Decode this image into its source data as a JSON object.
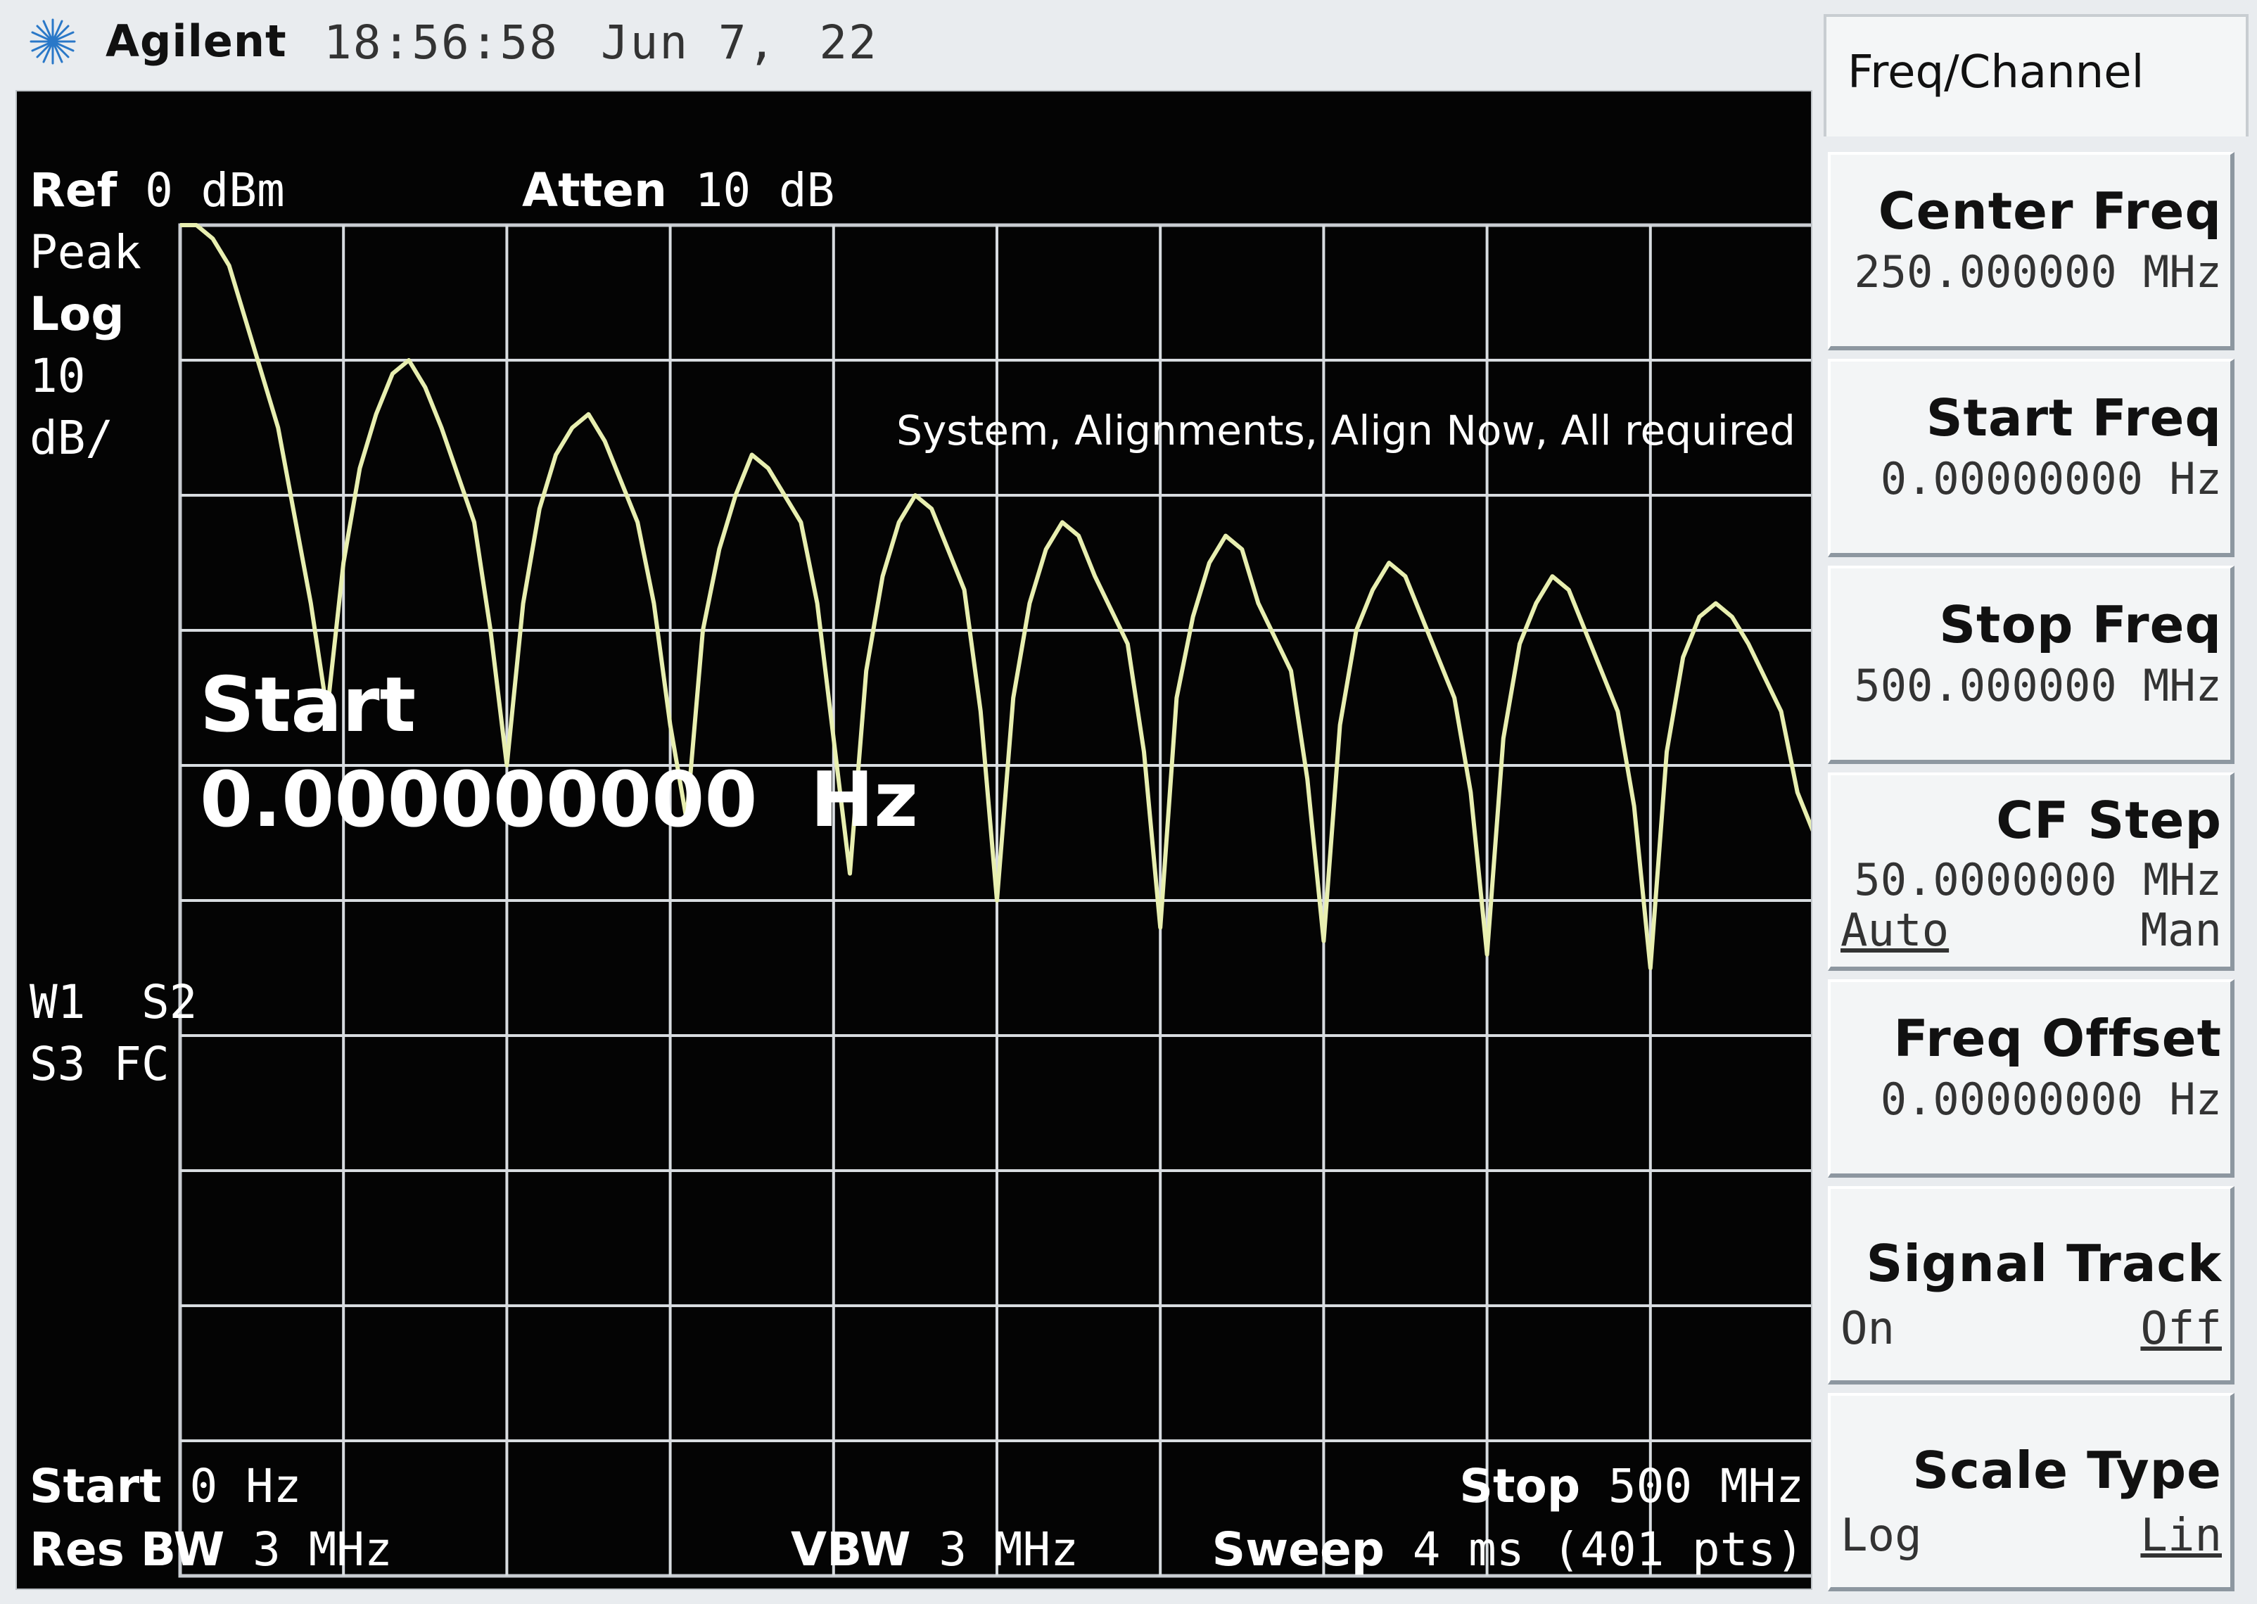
{
  "header": {
    "brand": "Agilent",
    "time": "18:56:58",
    "date_day": "Jun 7,",
    "date_year": "22"
  },
  "screen": {
    "ref_label": "Ref",
    "ref_value": "0 dBm",
    "atten_label": "Atten",
    "atten_value": "10 dB",
    "detector": "Peak",
    "scale_type": "Log",
    "scale_value": "10",
    "scale_unit": "dB/",
    "trace_flags_1": "W1  S2",
    "trace_flags_2": "S3 FC",
    "message": "System, Alignments, Align Now, All required",
    "entry_label": "Start",
    "entry_value": "0.000000000  Hz",
    "start_label": "Start",
    "start_value": "0 Hz",
    "stop_label": "Stop",
    "stop_value": "500 MHz",
    "rbw_label": "Res BW",
    "rbw_value": "3 MHz",
    "vbw_label": "VBW",
    "vbw_value": "3 MHz",
    "sweep_label": "Sweep",
    "sweep_value": "4 ms (401 pts)"
  },
  "chart_data": {
    "type": "line",
    "xlabel": "",
    "ylabel": "",
    "xlim": [
      0,
      500
    ],
    "ylim": [
      -100,
      0
    ],
    "grid": true,
    "trace_color": "#e8efb0",
    "series": [
      {
        "x": [
          0,
          5,
          10,
          15,
          20,
          30,
          40,
          45,
          50,
          55,
          60,
          65,
          70,
          75,
          80,
          90,
          95,
          100,
          105,
          110,
          115,
          120,
          125,
          130,
          140,
          145,
          150,
          155,
          160,
          165,
          170,
          175,
          180,
          190,
          195,
          200,
          205,
          210,
          215,
          220,
          225,
          230,
          240,
          245,
          250,
          255,
          260,
          265,
          270,
          275,
          280,
          290,
          295,
          300,
          305,
          310,
          315,
          320,
          325,
          330,
          340,
          345,
          350,
          355,
          360,
          365,
          370,
          375,
          380,
          390,
          395,
          400,
          405,
          410,
          415,
          420,
          425,
          430,
          440,
          445,
          450,
          455,
          460,
          465,
          470,
          475,
          480,
          490,
          495,
          500
        ],
        "values": [
          0,
          0,
          -1,
          -3,
          -7,
          -15,
          -28,
          -36,
          -25,
          -18,
          -14,
          -11,
          -10,
          -12,
          -15,
          -22,
          -30,
          -40,
          -28,
          -21,
          -17,
          -15,
          -14,
          -16,
          -22,
          -28,
          -37,
          -44,
          -30,
          -24,
          -20,
          -17,
          -18,
          -22,
          -28,
          -38,
          -48,
          -33,
          -26,
          -22,
          -20,
          -21,
          -27,
          -36,
          -50,
          -35,
          -28,
          -24,
          -22,
          -23,
          -26,
          -31,
          -39,
          -52,
          -35,
          -29,
          -25,
          -23,
          -24,
          -28,
          -33,
          -41,
          -53,
          -37,
          -30,
          -27,
          -25,
          -26,
          -29,
          -35,
          -42,
          -54,
          -38,
          -31,
          -28,
          -26,
          -27,
          -30,
          -36,
          -43,
          -55,
          -39,
          -32,
          -29,
          -28,
          -29,
          -31,
          -36,
          -42,
          -45
        ]
      }
    ]
  },
  "softkeys": {
    "menu_title": "Freq/Channel",
    "center_freq": {
      "label": "Center Freq",
      "value": "250.000000 MHz"
    },
    "start_freq": {
      "label": "Start Freq",
      "value": "0.00000000  Hz"
    },
    "stop_freq": {
      "label": "Stop Freq",
      "value": "500.000000 MHz"
    },
    "cf_step": {
      "label": "CF Step",
      "value": "50.0000000 MHz",
      "opt_left": "Auto",
      "opt_right": "Man"
    },
    "freq_offset": {
      "label": "Freq Offset",
      "value": "0.00000000  Hz"
    },
    "signal_track": {
      "label": "Signal Track",
      "opt_left": "On",
      "opt_right": "Off"
    },
    "scale_type": {
      "label": "Scale Type",
      "opt_left": "Log",
      "opt_right": "Lin"
    }
  }
}
